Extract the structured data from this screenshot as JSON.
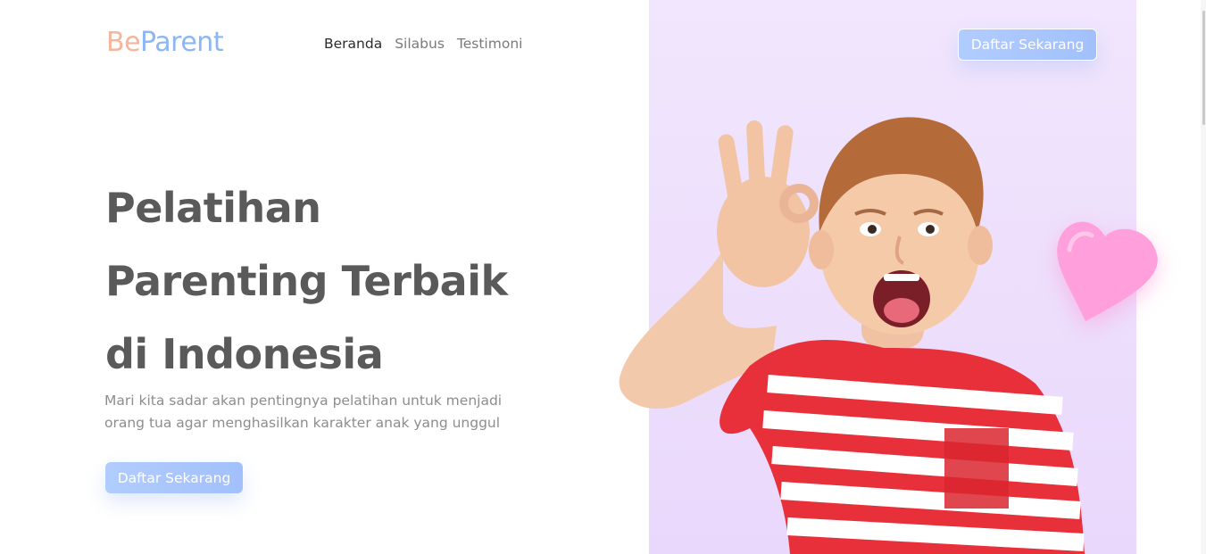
{
  "logo": {
    "part1": "Be",
    "part2": "Parent"
  },
  "nav": {
    "items": [
      {
        "label": "Beranda"
      },
      {
        "label": "Silabus"
      },
      {
        "label": "Testimoni"
      }
    ]
  },
  "header": {
    "cta_label": "Daftar Sekarang"
  },
  "hero": {
    "title_lines": [
      "Pelatihan",
      "Parenting Terbaik",
      "di Indonesia"
    ],
    "subtitle_line1": "Mari kita sadar akan pentingnya pelatihan untuk menjadi",
    "subtitle_line2": "orang tua agar menghasilkan karakter anak yang unggul",
    "cta_label": "Daftar Sekarang"
  },
  "icons": {
    "hero_image": "child-okay-sign-photo",
    "decoration": "heart-icon"
  },
  "colors": {
    "logo_be": "#f6b49a",
    "logo_parent": "#8db6f4",
    "button": "#a2c0fb",
    "heading": "#5a5a5a",
    "panel": "#efe2fd",
    "heart": "#ff9fdc"
  }
}
